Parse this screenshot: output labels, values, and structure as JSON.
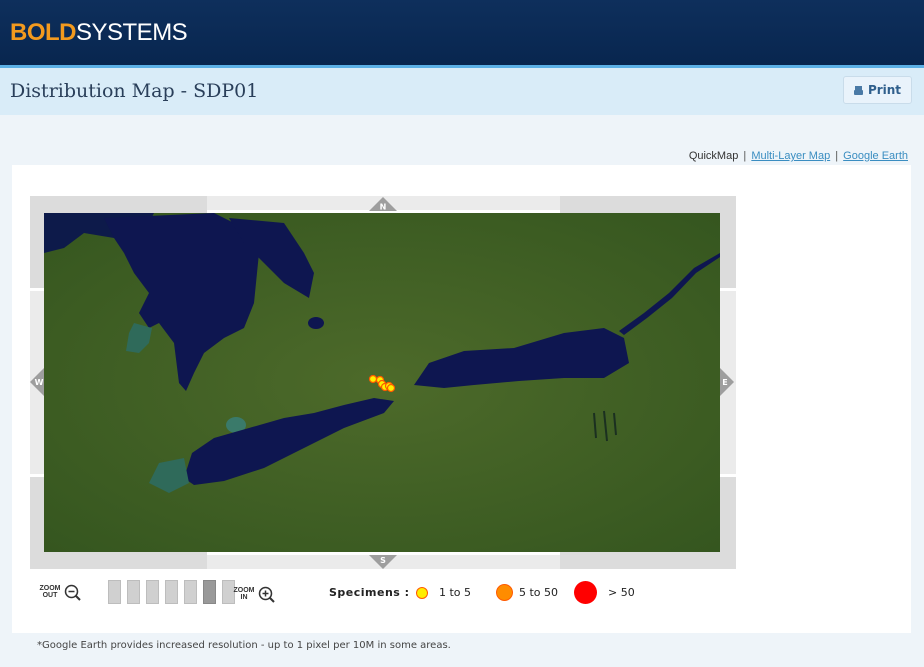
{
  "header": {
    "logo_bold": "BOLD",
    "logo_rest": "SYSTEMS",
    "colors": {
      "logo_accent": "#f39a1e",
      "header_bg": "#0a2a55",
      "strip": "#5bb0e6"
    }
  },
  "titlebar": {
    "title": "Distribution Map - SDP01",
    "print_label": "Print",
    "print_icon": "printer-icon"
  },
  "map_switch": {
    "current": "QuickMap",
    "separator": "|",
    "links": [
      "Multi-Layer Map",
      "Google Earth"
    ]
  },
  "map": {
    "region": "Great Lakes region (Lake Huron, Lake Erie, Lake Ontario) satellite view",
    "nav": {
      "north": "N",
      "south": "S",
      "west": "W",
      "east": "E"
    },
    "specimen_points": [
      {
        "category": "1 to 5"
      },
      {
        "category": "1 to 5"
      },
      {
        "category": "1 to 5"
      },
      {
        "category": "1 to 5"
      },
      {
        "category": "1 to 5"
      },
      {
        "category": "1 to 5"
      }
    ]
  },
  "zoom": {
    "out_label_1": "ZOOM",
    "out_label_2": "OUT",
    "in_label_1": "ZOOM",
    "in_label_2": "IN",
    "levels": 7,
    "current_level": 6,
    "out_icon": "zoom-out-icon",
    "in_icon": "zoom-in-icon"
  },
  "legend": {
    "title": "Specimens :",
    "items": [
      {
        "label": "1 to 5",
        "color": "#ffee00",
        "ring": "#ff5a00"
      },
      {
        "label": "5 to 50",
        "color": "#ff8c00",
        "ring": "#ff5a00"
      },
      {
        "label": "> 50",
        "color": "#ff0000",
        "ring": "#ff0000"
      }
    ]
  },
  "footnote": "*Google Earth provides increased resolution - up to 1 pixel per 10M in some areas."
}
